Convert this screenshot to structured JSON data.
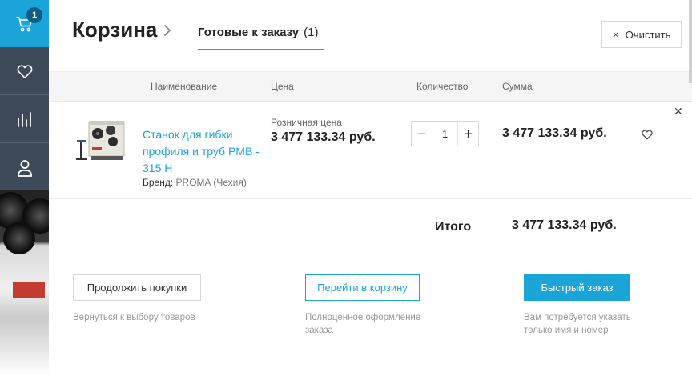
{
  "sidebar": {
    "cart_badge": "1",
    "items": [
      {
        "name": "cart",
        "icon": "cart-icon",
        "active": true
      },
      {
        "name": "favorites",
        "icon": "heart-icon",
        "active": false
      },
      {
        "name": "compare",
        "icon": "bar-chart-icon",
        "active": false
      },
      {
        "name": "account",
        "icon": "user-icon",
        "active": false
      }
    ]
  },
  "header": {
    "title": "Корзина",
    "tab_label": "Готовые к заказу",
    "tab_count": "(1)",
    "clear_label": "Очистить"
  },
  "table": {
    "columns": {
      "name": "Наименование",
      "price": "Цена",
      "quantity": "Количество",
      "sum": "Сумма"
    },
    "items": [
      {
        "name": "Станок для гибки профиля и труб PMB - 315 H",
        "brand_label": "Бренд:",
        "brand": "PROMA (Чехия)",
        "price_label": "Розничная цена",
        "price": "3 477 133.34 руб.",
        "quantity": "1",
        "sum": "3 477 133.34 руб."
      }
    ]
  },
  "total": {
    "label": "Итого",
    "value": "3 477 133.34 руб."
  },
  "actions": {
    "continue_label": "Продолжить покупки",
    "continue_hint": "Вернуться к выбору товаров",
    "cart_label": "Перейти в корзину",
    "cart_hint": "Полноценное оформление заказа",
    "quick_label": "Быстрый заказ",
    "quick_hint": "Вам потребуется указать только имя и номер"
  },
  "colors": {
    "accent": "#1aa4d8",
    "sidebar": "#3d4a5a"
  }
}
